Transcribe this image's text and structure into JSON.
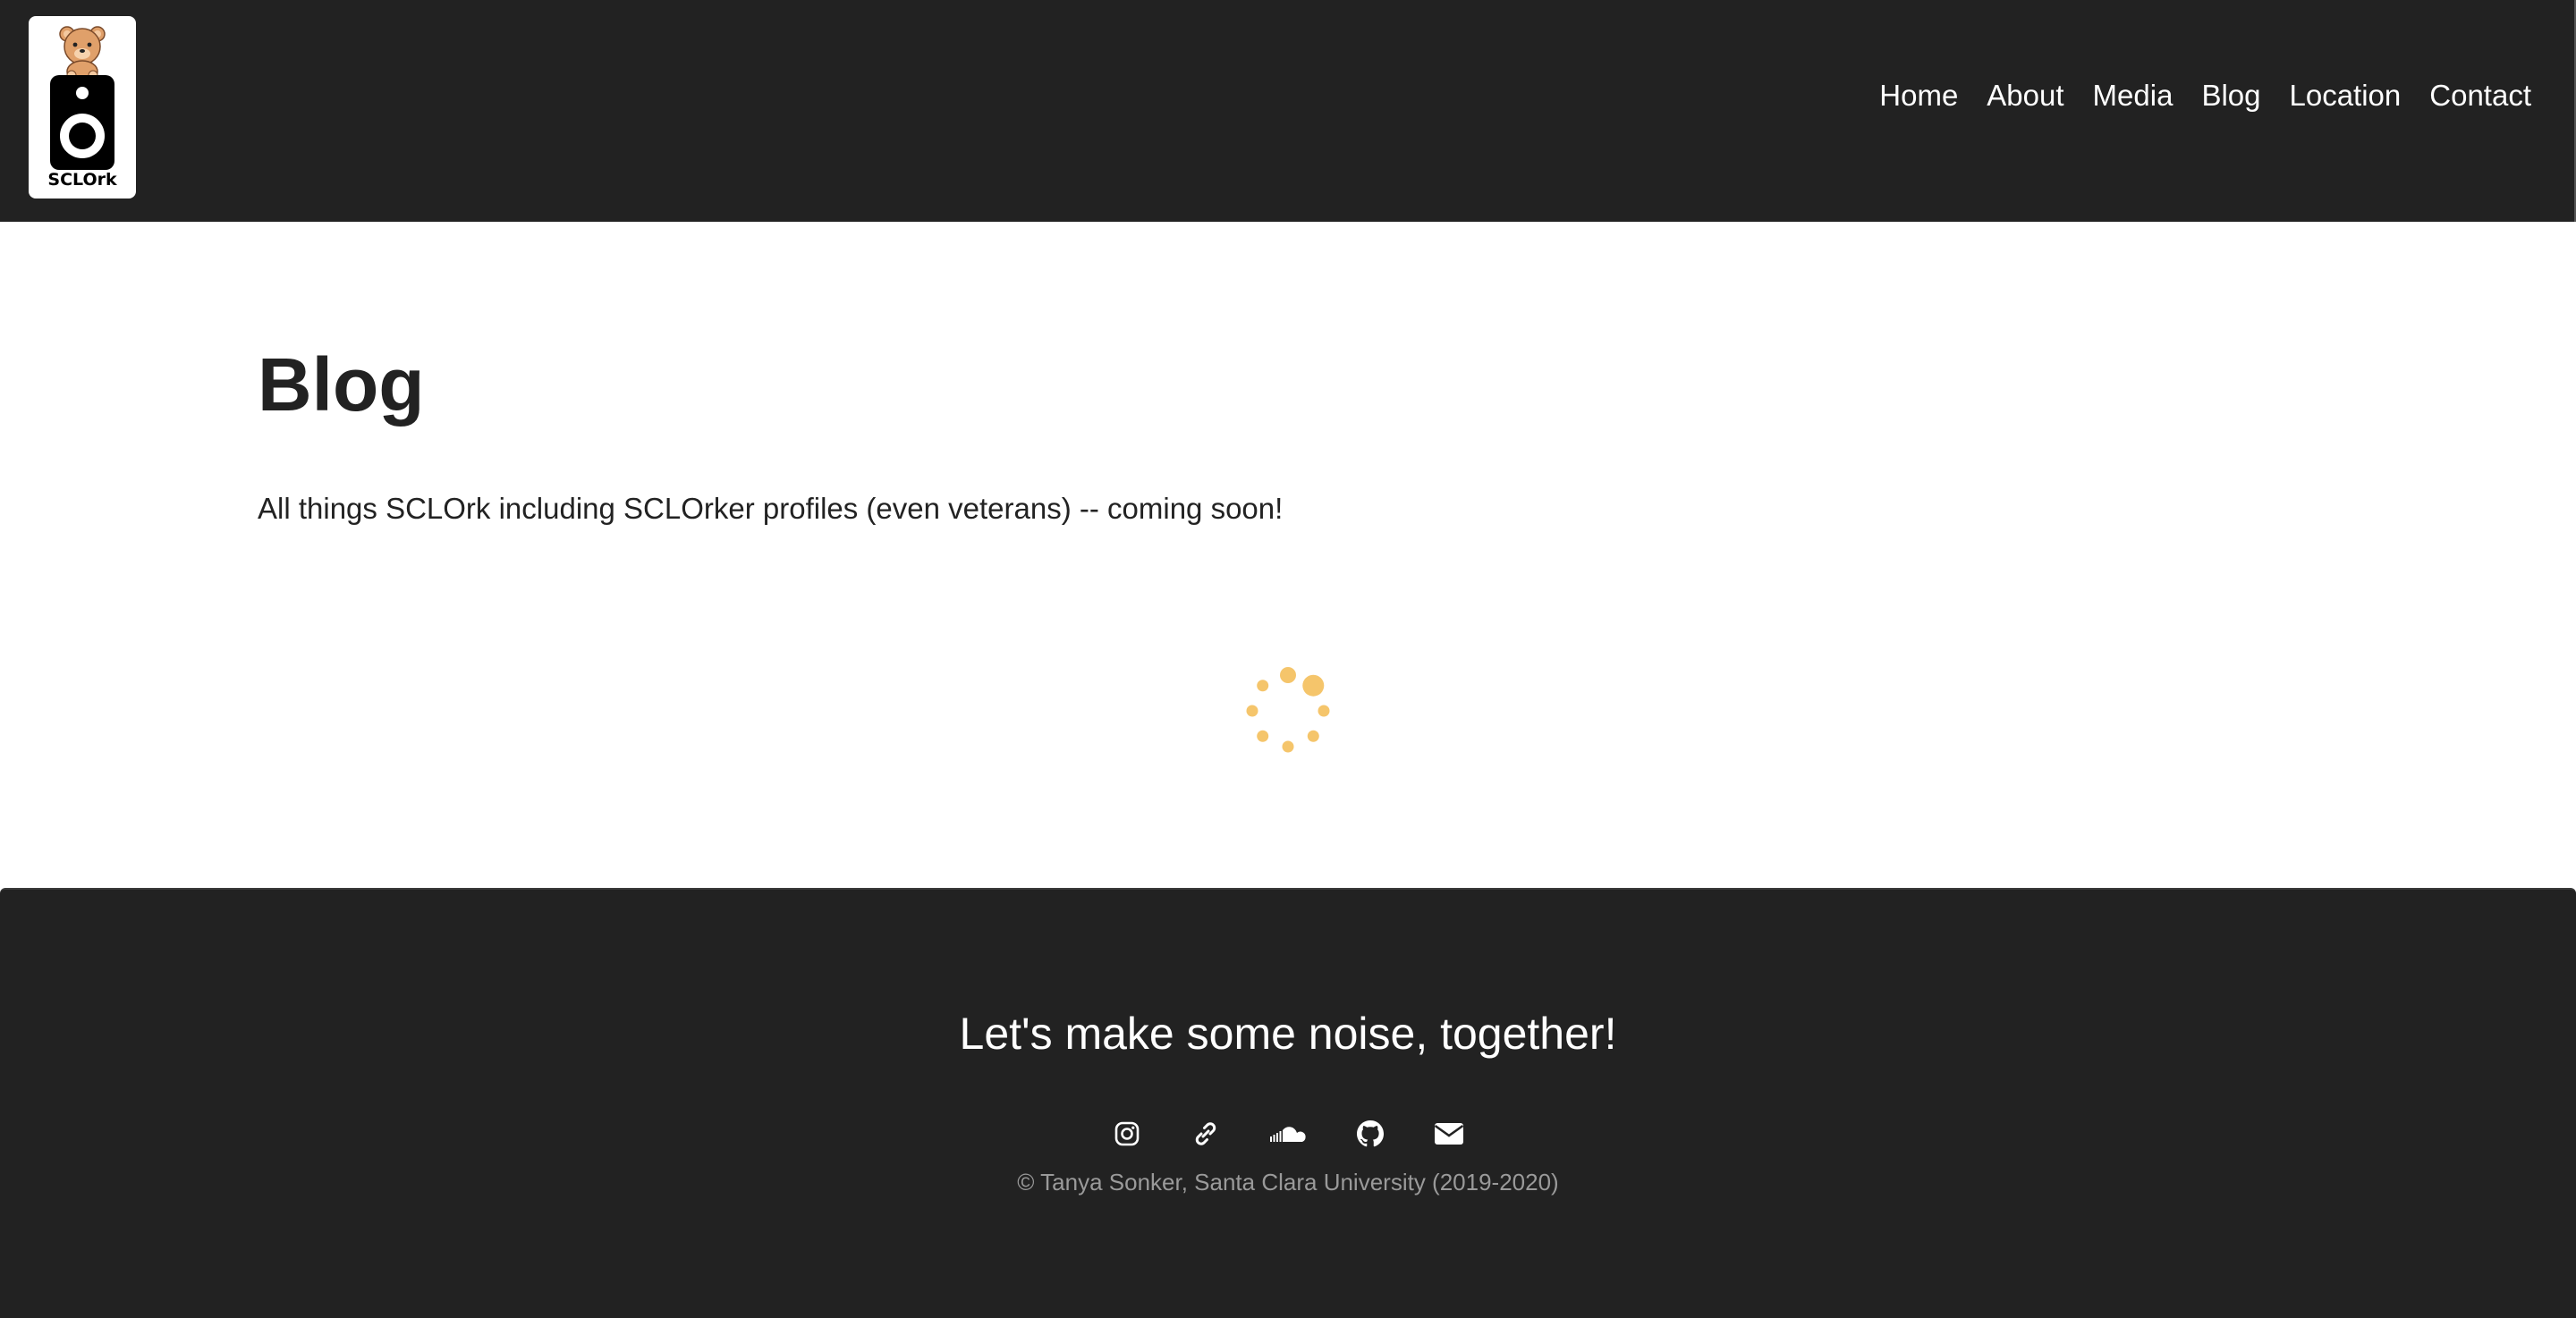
{
  "header": {
    "logo_text": "SCLOrk",
    "nav": [
      {
        "label": "Home"
      },
      {
        "label": "About"
      },
      {
        "label": "Media"
      },
      {
        "label": "Blog"
      },
      {
        "label": "Location"
      },
      {
        "label": "Contact"
      }
    ]
  },
  "main": {
    "title": "Blog",
    "intro": "All things SCLOrk including SCLOrker profiles (even veterans) -- coming soon!",
    "spinner_color": "#f5c56b"
  },
  "footer": {
    "tagline": "Let's make some noise, together!",
    "social_icons": [
      "instagram-icon",
      "link-icon",
      "soundcloud-icon",
      "github-icon",
      "email-icon"
    ],
    "copyright": "© Tanya Sonker, Santa Clara University (2019-2020)"
  },
  "colors": {
    "header_bg": "#222222",
    "footer_bg": "#222222",
    "text_dark": "#222222",
    "copyright_gray": "#9a9a9a"
  }
}
